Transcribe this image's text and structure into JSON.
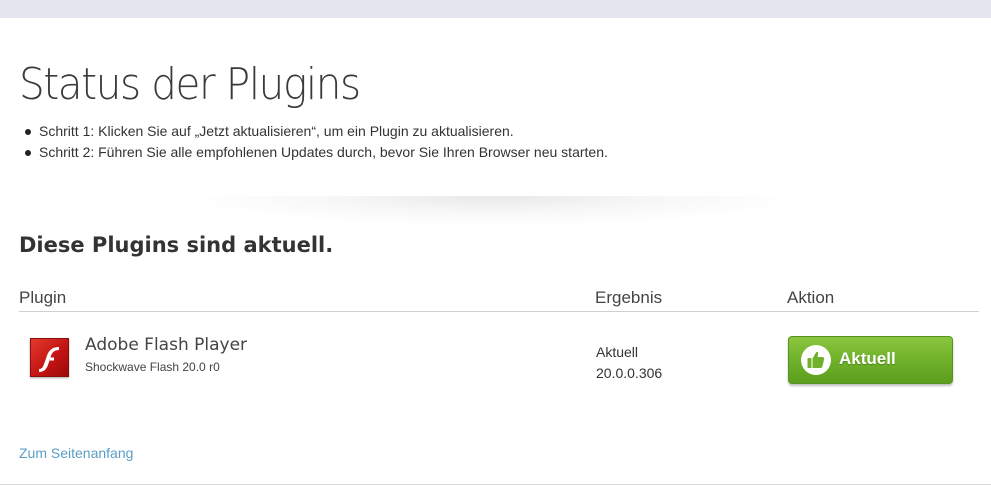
{
  "header": {
    "title": "Status der Plugins",
    "steps": [
      "Schritt 1: Klicken Sie auf „Jetzt aktualisieren“, um ein Plugin zu aktualisieren.",
      "Schritt 2: Führen Sie alle empfohlenen Updates durch, bevor Sie Ihren Browser neu starten."
    ]
  },
  "section": {
    "heading": "Diese Plugins sind aktuell."
  },
  "table": {
    "columns": [
      "Plugin",
      "Ergebnis",
      "Aktion"
    ],
    "rows": [
      {
        "icon": "flash-player-icon",
        "name": "Adobe Flash Player",
        "version": "Shockwave Flash 20.0 r0",
        "result_status": "Aktuell",
        "result_version": "20.0.0.306",
        "action_label": "Aktuell",
        "action_icon": "thumbs-up-icon"
      }
    ]
  },
  "footer": {
    "back_to_top": "Zum Seitenanfang"
  },
  "colors": {
    "accent_green": "#6fb12a",
    "link_blue": "#5a9ec8",
    "flash_red": "#c41414"
  }
}
